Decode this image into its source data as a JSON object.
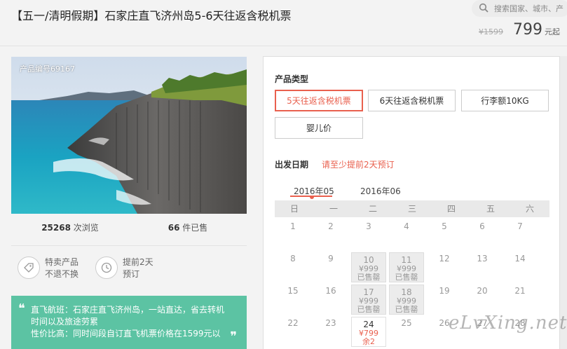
{
  "header": {
    "title": "【五一/清明假期】石家庄直飞济州岛5-6天往返含税机票",
    "search_placeholder": "搜索国家、城市、产",
    "original_price": "¥1599",
    "price": "799",
    "price_suffix": "元起"
  },
  "photo": {
    "code_label": "产品编号69167"
  },
  "stats": [
    {
      "value": "25268",
      "label": "次浏览"
    },
    {
      "value": "66",
      "label": "件已售"
    }
  ],
  "features": [
    {
      "icon": "tag-icon",
      "line1": "特卖产品",
      "line2": "不退不换"
    },
    {
      "icon": "clock-icon",
      "line1": "提前2天",
      "line2": "预订"
    }
  ],
  "promo": {
    "open_quote": "❝",
    "close_quote": "❞",
    "line1": "直飞航班：石家庄直飞济州岛，一站直达，省去转机",
    "line2": "时间以及旅途劳累",
    "line3": "性价比高：同时间段自订直飞机票价格在1599元以"
  },
  "panel": {
    "product_type_label": "产品类型",
    "options": [
      {
        "label": "5天往返含税机票",
        "selected": true
      },
      {
        "label": "6天往返含税机票",
        "selected": false
      },
      {
        "label": "行李额10KG",
        "selected": false
      },
      {
        "label": "婴儿价",
        "selected": false
      }
    ],
    "date_label": "出发日期",
    "date_hint": "请至少提前2天预订",
    "months": [
      "2016年05",
      "2016年06"
    ],
    "weekdays": [
      "日",
      "一",
      "二",
      "三",
      "四",
      "五",
      "六"
    ],
    "calendar": [
      {
        "day": "1"
      },
      {
        "day": "2"
      },
      {
        "day": "3"
      },
      {
        "day": "4"
      },
      {
        "day": "5"
      },
      {
        "day": "6"
      },
      {
        "day": "7"
      },
      {
        "day": "8"
      },
      {
        "day": "9"
      },
      {
        "day": "10",
        "price": "¥999",
        "status": "已售罄"
      },
      {
        "day": "11",
        "price": "¥999",
        "status": "已售罄"
      },
      {
        "day": "12"
      },
      {
        "day": "13"
      },
      {
        "day": "14"
      },
      {
        "day": "15"
      },
      {
        "day": "16"
      },
      {
        "day": "17",
        "price": "¥999",
        "status": "已售罄"
      },
      {
        "day": "18",
        "price": "¥999",
        "status": "已售罄"
      },
      {
        "day": "19"
      },
      {
        "day": "20"
      },
      {
        "day": "21"
      },
      {
        "day": "22"
      },
      {
        "day": "23"
      },
      {
        "day": "24",
        "price": "¥799",
        "status": "余2",
        "available": true
      },
      {
        "day": "25"
      },
      {
        "day": "26"
      },
      {
        "day": "27"
      },
      {
        "day": "28"
      }
    ]
  },
  "watermark": "eLvXing.net",
  "colors": {
    "accent": "#e9604e",
    "promo_bg": "#5cc3a3"
  }
}
